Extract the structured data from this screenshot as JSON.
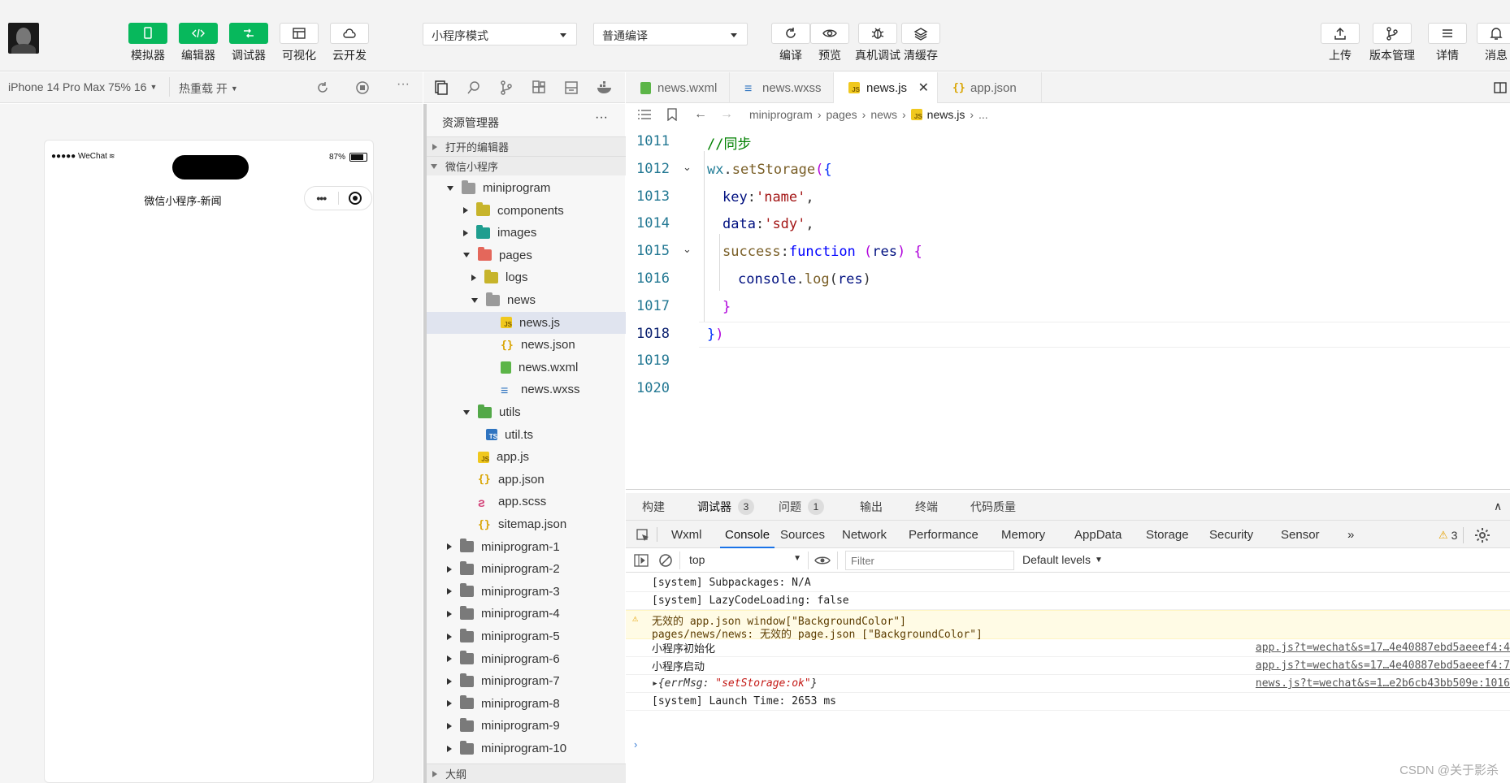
{
  "toolbar": {
    "left_buttons": [
      {
        "label": "模拟器",
        "icon": "phone-icon"
      },
      {
        "label": "编辑器",
        "icon": "code-icon"
      },
      {
        "label": "调试器",
        "icon": "debug-icon"
      },
      {
        "label": "可视化",
        "icon": "layout-icon"
      },
      {
        "label": "云开发",
        "icon": "cloud-icon"
      }
    ],
    "mode_select": "小程序模式",
    "compile_select": "普通编译",
    "mid_buttons": [
      {
        "label": "编译",
        "icon": "refresh-icon"
      },
      {
        "label": "预览",
        "icon": "eye-icon"
      },
      {
        "label": "真机调试",
        "icon": "bug-icon"
      },
      {
        "label": "清缓存",
        "icon": "layers-icon"
      }
    ],
    "right_buttons": [
      {
        "label": "上传",
        "icon": "upload-icon"
      },
      {
        "label": "版本管理",
        "icon": "branch-icon"
      },
      {
        "label": "详情",
        "icon": "menu-icon"
      },
      {
        "label": "消息",
        "icon": "bell-icon"
      }
    ]
  },
  "simbar": {
    "device": "iPhone 14 Pro Max 75% 16",
    "hot_reload": "热重载 开"
  },
  "phone": {
    "carrier": "●●●●● WeChat",
    "battery": "87%",
    "title": "微信小程序-新闻"
  },
  "explorer": {
    "title": "资源管理器",
    "open_editors": "打开的编辑器",
    "project": "微信小程序",
    "outline": "大纲",
    "items": [
      {
        "label": "miniprogram",
        "depth": 1,
        "twisty": "open",
        "icon": "fold open"
      },
      {
        "label": "components",
        "depth": 2,
        "twisty": "closed",
        "icon": "fold yellow"
      },
      {
        "label": "images",
        "depth": 2,
        "twisty": "closed",
        "icon": "fold teal"
      },
      {
        "label": "pages",
        "depth": 2,
        "twisty": "open",
        "icon": "fold red"
      },
      {
        "label": "logs",
        "depth": 3,
        "twisty": "closed",
        "icon": "fold yellow"
      },
      {
        "label": "news",
        "depth": 3,
        "twisty": "open",
        "icon": "fold open"
      },
      {
        "label": "news.js",
        "depth": 4,
        "twisty": "none",
        "icon": "fi-js",
        "selected": true
      },
      {
        "label": "news.json",
        "depth": 4,
        "twisty": "none",
        "icon": "fi-json"
      },
      {
        "label": "news.wxml",
        "depth": 4,
        "twisty": "none",
        "icon": "fi-wxml"
      },
      {
        "label": "news.wxss",
        "depth": 4,
        "twisty": "none",
        "icon": "fi-wxss"
      },
      {
        "label": "utils",
        "depth": 2,
        "twisty": "open",
        "icon": "fold green"
      },
      {
        "label": "util.ts",
        "depth": 3,
        "twisty": "none",
        "icon": "fi-ts"
      },
      {
        "label": "app.js",
        "depth": 2,
        "twisty": "none",
        "icon": "fi-js"
      },
      {
        "label": "app.json",
        "depth": 2,
        "twisty": "none",
        "icon": "fi-json"
      },
      {
        "label": "app.scss",
        "depth": 2,
        "twisty": "none",
        "icon": "fi-scss"
      },
      {
        "label": "sitemap.json",
        "depth": 2,
        "twisty": "none",
        "icon": "fi-json"
      },
      {
        "label": "miniprogram-1",
        "depth": 1,
        "twisty": "closed",
        "icon": "fold"
      },
      {
        "label": "miniprogram-2",
        "depth": 1,
        "twisty": "closed",
        "icon": "fold"
      },
      {
        "label": "miniprogram-3",
        "depth": 1,
        "twisty": "closed",
        "icon": "fold"
      },
      {
        "label": "miniprogram-4",
        "depth": 1,
        "twisty": "closed",
        "icon": "fold"
      },
      {
        "label": "miniprogram-5",
        "depth": 1,
        "twisty": "closed",
        "icon": "fold"
      },
      {
        "label": "miniprogram-6",
        "depth": 1,
        "twisty": "closed",
        "icon": "fold"
      },
      {
        "label": "miniprogram-7",
        "depth": 1,
        "twisty": "closed",
        "icon": "fold"
      },
      {
        "label": "miniprogram-8",
        "depth": 1,
        "twisty": "closed",
        "icon": "fold"
      },
      {
        "label": "miniprogram-9",
        "depth": 1,
        "twisty": "closed",
        "icon": "fold"
      },
      {
        "label": "miniprogram-10",
        "depth": 1,
        "twisty": "closed",
        "icon": "fold"
      }
    ]
  },
  "tabs": [
    {
      "label": "news.wxml",
      "icon": "fi-wxml",
      "active": false
    },
    {
      "label": "news.wxss",
      "icon": "fi-wxss",
      "active": false
    },
    {
      "label": "news.js",
      "icon": "fi-js",
      "active": true
    },
    {
      "label": "app.json",
      "icon": "fi-json",
      "active": false
    }
  ],
  "breadcrumb": [
    "miniprogram",
    "pages",
    "news",
    "news.js",
    "..."
  ],
  "code": [
    {
      "ln": "1011",
      "indent": 0,
      "tokens": [
        [
          "c-comment",
          "//同步"
        ]
      ]
    },
    {
      "ln": "1012",
      "indent": 0,
      "fold": true,
      "tokens": [
        [
          "c-obj",
          "wx"
        ],
        [
          "",
          "."
        ],
        [
          "c-fn",
          "setStorage"
        ],
        [
          "c-br1",
          "("
        ],
        [
          "c-br2",
          "{"
        ]
      ]
    },
    {
      "ln": "1013",
      "indent": 1,
      "tokens": [
        [
          "c-prop",
          "key"
        ],
        [
          "",
          ":"
        ],
        [
          "c-str",
          "'name'"
        ],
        [
          "",
          ","
        ]
      ]
    },
    {
      "ln": "1014",
      "indent": 1,
      "tokens": [
        [
          "c-prop",
          "data"
        ],
        [
          "",
          ":"
        ],
        [
          "c-str",
          "'sdy'"
        ],
        [
          "",
          ","
        ]
      ]
    },
    {
      "ln": "1015",
      "indent": 1,
      "fold": true,
      "tokens": [
        [
          "c-fn",
          "success"
        ],
        [
          "",
          ":"
        ],
        [
          "c-kw",
          "function"
        ],
        [
          "",
          " "
        ],
        [
          "c-br1",
          "("
        ],
        [
          "c-prop",
          "res"
        ],
        [
          "c-br1",
          ")"
        ],
        [
          "",
          " "
        ],
        [
          "c-br1",
          "{"
        ]
      ]
    },
    {
      "ln": "1016",
      "indent": 2,
      "tokens": [
        [
          "c-prop",
          "console"
        ],
        [
          "",
          "."
        ],
        [
          "c-fn",
          "log"
        ],
        [
          "",
          "("
        ],
        [
          "c-prop",
          "res"
        ],
        [
          "",
          ")"
        ]
      ]
    },
    {
      "ln": "1017",
      "indent": 1,
      "tokens": [
        [
          "c-br1",
          "}"
        ]
      ]
    },
    {
      "ln": "1018",
      "indent": 0,
      "current": true,
      "tokens": [
        [
          "c-br2",
          "}"
        ],
        [
          "c-br1",
          ")"
        ]
      ]
    },
    {
      "ln": "1019",
      "indent": 0,
      "tokens": []
    },
    {
      "ln": "1020",
      "indent": 0,
      "tokens": []
    }
  ],
  "devtools": {
    "top_tabs": [
      {
        "label": "构建"
      },
      {
        "label": "调试器",
        "badge": "3",
        "active": true
      },
      {
        "label": "问题",
        "badge": "1"
      },
      {
        "label": "输出"
      },
      {
        "label": "终端"
      },
      {
        "label": "代码质量"
      }
    ],
    "panel_tabs": [
      "Wxml",
      "Console",
      "Sources",
      "Network",
      "Performance",
      "Memory",
      "AppData",
      "Storage",
      "Security",
      "Sensor"
    ],
    "active_panel": "Console",
    "warning_count": "3",
    "context": "top",
    "filter_placeholder": "Filter",
    "levels": "Default levels",
    "console_lines": [
      {
        "msg": "[system] Subpackages: N/A",
        "src": ""
      },
      {
        "msg": "[system] LazyCodeLoading: false",
        "src": ""
      },
      {
        "msg": "无效的 app.json window[\"BackgroundColor\"]",
        "msg2": "pages/news/news: 无效的 page.json [\"BackgroundColor\"]",
        "warn": true,
        "src": ""
      },
      {
        "msg": "小程序初始化",
        "src": "app.js?t=wechat&s=17…4e40887ebd5aeeef4:4"
      },
      {
        "msg": "小程序启动",
        "src": "app.js?t=wechat&s=17…4e40887ebd5aeeef4:7"
      },
      {
        "msg": "▸{errMsg: \"setStorage:ok\"}",
        "src": "news.js?t=wechat&s=1…e2b6cb43bb509e:1016",
        "obj": true
      },
      {
        "msg": "[system] Launch Time: 2653 ms",
        "src": ""
      }
    ],
    "watermark": "CSDN @关于影杀"
  },
  "colors": {
    "accent_green": "#07b85c",
    "line_number": "#237893"
  }
}
